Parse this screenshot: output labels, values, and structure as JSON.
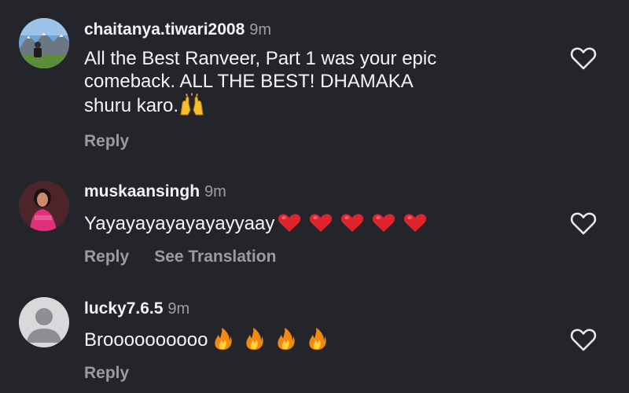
{
  "comments": [
    {
      "username": "chaitanya.tiwari2008",
      "time": "9m",
      "text_lines": [
        "All the Best Ranveer, Part 1 was your epic",
        "comeback. ALL THE BEST! DHAMAKA",
        "shuru karo."
      ],
      "trailing_emoji": "raising-hands",
      "actions": [
        "Reply"
      ],
      "avatar": "mountain-photo"
    },
    {
      "username": "muskaansingh",
      "time": "9m",
      "text": "Yayayayayayayayyaay",
      "trailing_emoji": "red-heart",
      "emoji_count": 5,
      "actions": [
        "Reply",
        "See Translation"
      ],
      "avatar": "person-photo"
    },
    {
      "username": "lucky7.6.5",
      "time": "9m",
      "text": "Broooooooooo",
      "trailing_emoji": "fire",
      "emoji_count": 4,
      "actions": [
        "Reply"
      ],
      "avatar": "default-user"
    }
  ],
  "colors": {
    "background": "#24252a",
    "text": "#f5f5f5",
    "muted": "#9a9ca1",
    "heart_emoji": "#e0242e",
    "fire_emoji": "#f28a12"
  },
  "icons": {
    "like": "heart-outline-icon"
  }
}
